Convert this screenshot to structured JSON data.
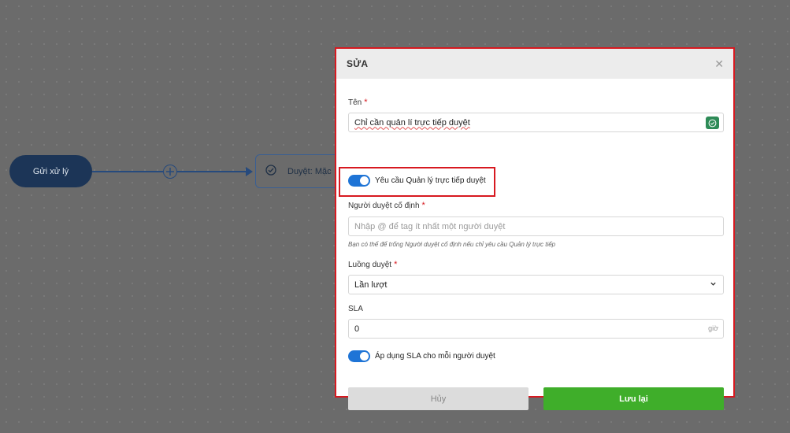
{
  "canvas": {
    "start_node_label": "Gửi xử lý",
    "step_node_label": "Duyệt: Mặc"
  },
  "modal": {
    "title": "SỬA",
    "name_label": "Tên",
    "required_mark": "*",
    "name_value": "Chỉ cần quản lí trực tiếp duyệt",
    "manager_toggle_label": "Yêu cầu Quản lý trực tiếp duyệt",
    "manager_toggle_on": true,
    "fixed_approver_label": "Người duyệt cố định",
    "fixed_approver_placeholder": "Nhập @ để tag ít nhất một người duyệt",
    "fixed_approver_hint": "Bạn có thể để trống Người duyệt cố định nếu chỉ yêu cầu Quản lý trực tiếp",
    "flow_label": "Luồng duyệt",
    "flow_value": "Lần lượt",
    "sla_label": "SLA",
    "sla_value": "0",
    "sla_unit": "giờ",
    "sla_toggle_label": "Áp dụng SLA cho mỗi người duyệt",
    "sla_toggle_on": true,
    "cancel_label": "Hủy",
    "save_label": "Lưu lại"
  },
  "colors": {
    "accent_blue": "#1e74d6",
    "save_green": "#3fae2a",
    "highlight_red": "#d71920"
  }
}
